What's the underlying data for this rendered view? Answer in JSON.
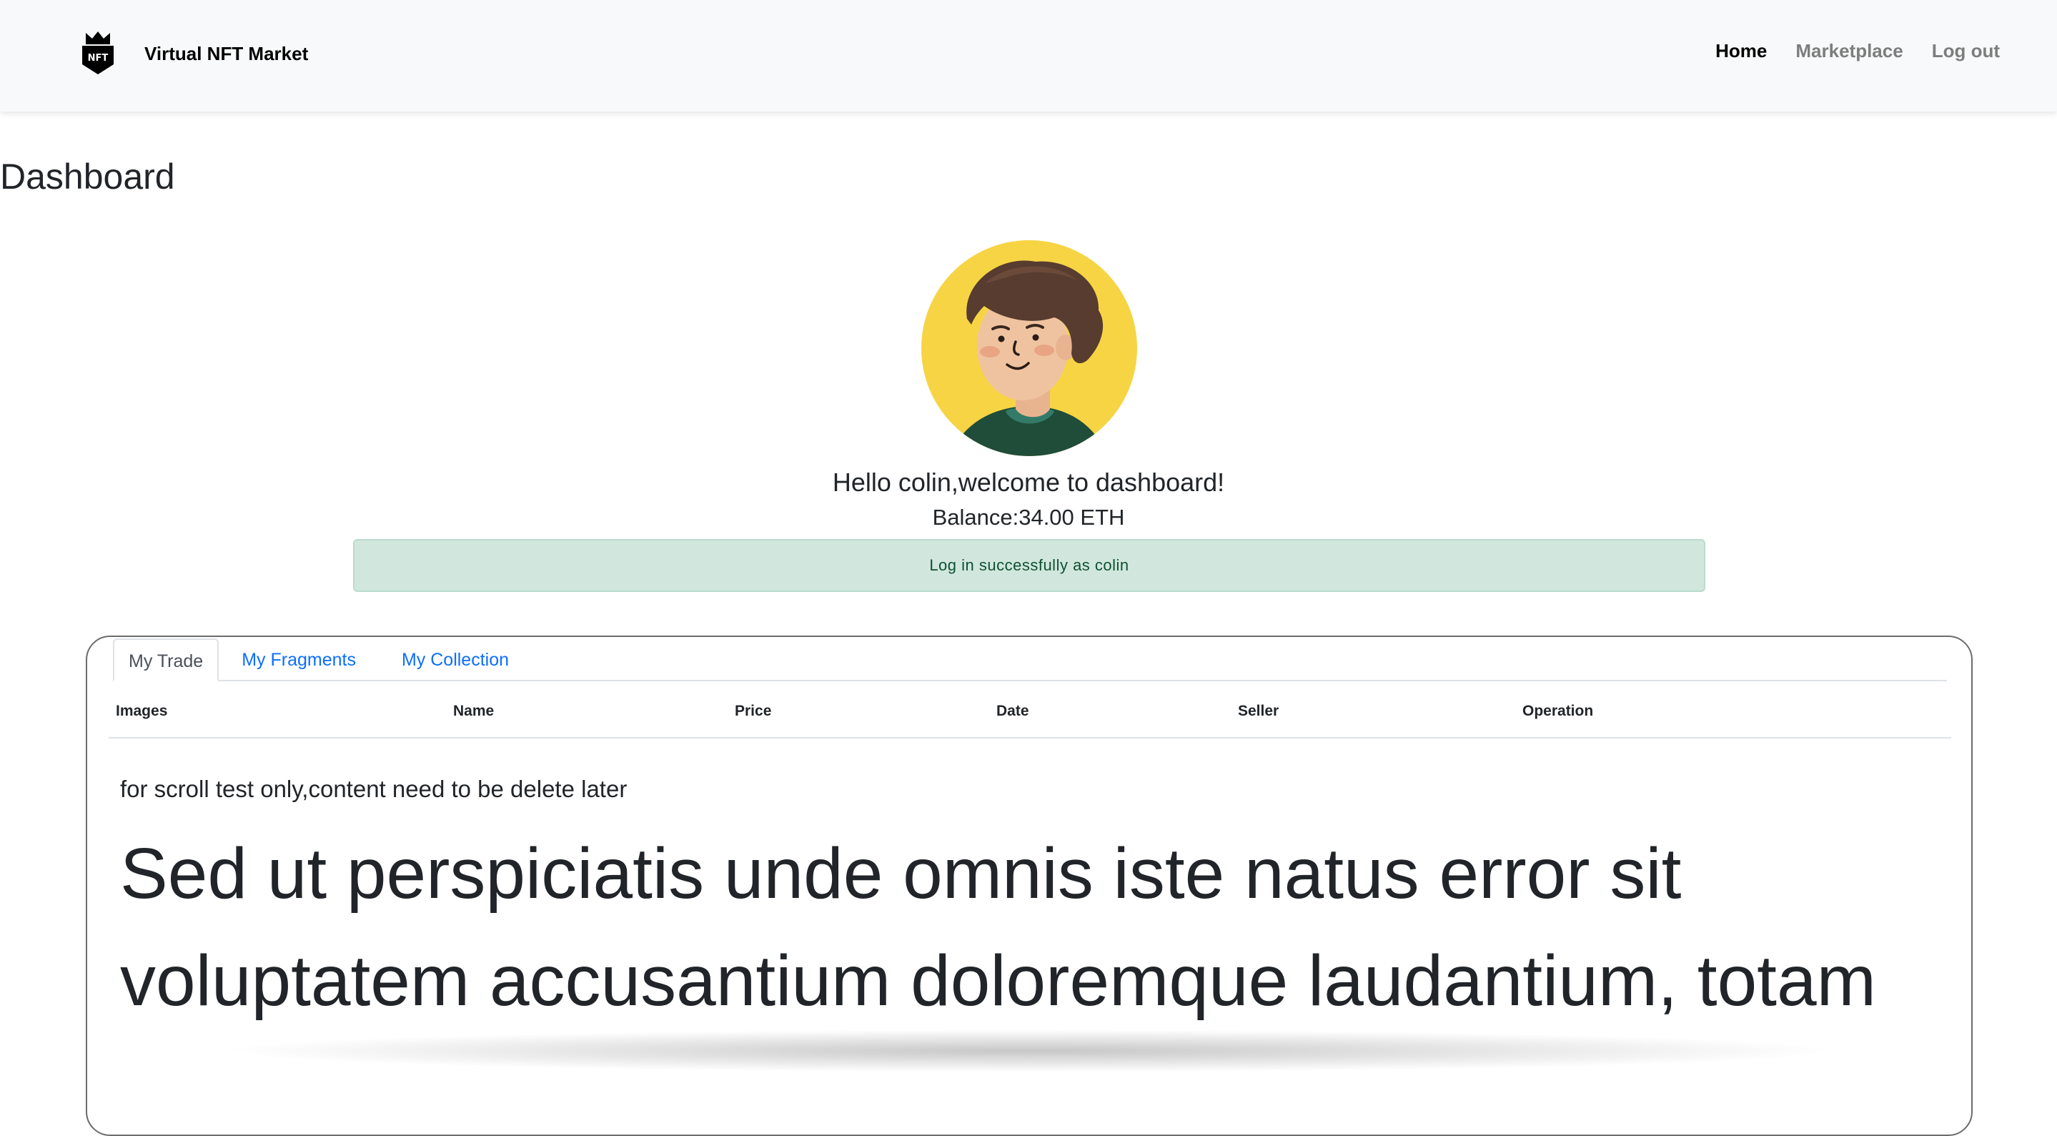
{
  "navbar": {
    "brand_logo_text": "NFT",
    "brand_name": "Virtual NFT Market",
    "links": [
      {
        "label": "Home",
        "active": true
      },
      {
        "label": "Marketplace",
        "active": false
      },
      {
        "label": "Log out",
        "active": false
      }
    ]
  },
  "page_title": "Dashboard",
  "avatar_icon": "avatar-illustration",
  "greeting": "Hello colin,welcome to dashboard!",
  "balance": "Balance:34.00 ETH",
  "alert": {
    "message": "Log in successfully as colin",
    "color": "#d1e7dd"
  },
  "tabs": [
    {
      "label": "My Trade",
      "active": true
    },
    {
      "label": "My Fragments",
      "active": false
    },
    {
      "label": "My Collection",
      "active": false
    }
  ],
  "table": {
    "columns": [
      "Images",
      "Name",
      "Price",
      "Date",
      "Seller",
      "Operation"
    ]
  },
  "note": "for scroll test only,content need to be delete later",
  "lorem": "Sed ut perspiciatis unde omnis iste natus error sit voluptatem accusantium doloremque laudantium, totam",
  "colors": {
    "link": "#0d6efd",
    "navbar_bg": "#f8f9fa",
    "avatar_bg": "#f7d444"
  }
}
